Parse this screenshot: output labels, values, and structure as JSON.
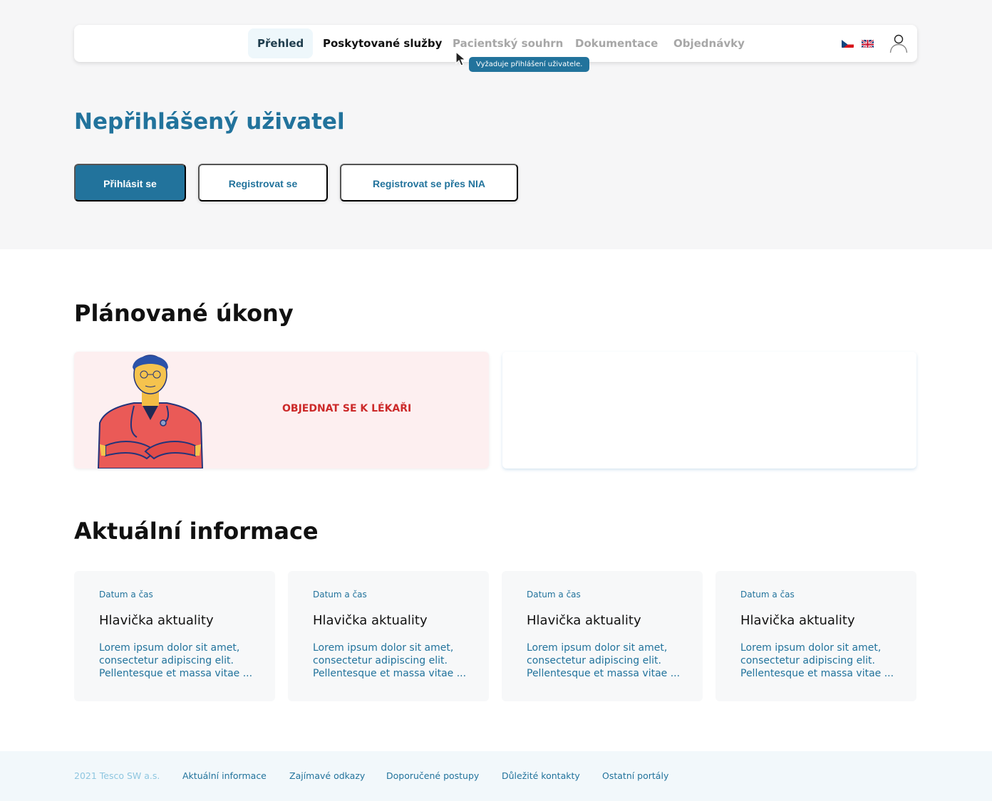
{
  "nav": {
    "items": [
      {
        "label": "Přehled",
        "state": "active"
      },
      {
        "label": "Poskytované služby",
        "state": "normal"
      },
      {
        "label": "Pacientský souhrn",
        "state": "disabled"
      },
      {
        "label": "Dokumentace",
        "state": "disabled"
      },
      {
        "label": "Objednávky",
        "state": "disabled"
      }
    ],
    "languages": [
      "cs",
      "en"
    ]
  },
  "tooltip": {
    "text": "Vyžaduje přihlášení uživatele."
  },
  "user": {
    "title": "Nepřihlášený uživatel"
  },
  "auth": {
    "login_label": "Přihlásit se",
    "register_label": "Registrovat se",
    "register_nia_label": "Registrovat se přes NIA"
  },
  "planned": {
    "title": "Plánované úkony",
    "order_label": "OBJEDNAT SE K LÉKAŘI"
  },
  "news": {
    "title": "Aktuální informace",
    "items": [
      {
        "date": "Datum a čas",
        "title": "Hlavička aktuality",
        "text": "Lorem ipsum dolor sit amet, consectetur adipiscing elit. Pellentesque et massa vitae ..."
      },
      {
        "date": "Datum a čas",
        "title": "Hlavička aktuality",
        "text": "Lorem ipsum dolor sit amet, consectetur adipiscing elit. Pellentesque et massa vitae ..."
      },
      {
        "date": "Datum a čas",
        "title": "Hlavička aktuality",
        "text": "Lorem ipsum dolor sit amet, consectetur adipiscing elit. Pellentesque et massa vitae ..."
      },
      {
        "date": "Datum a čas",
        "title": "Hlavička aktuality",
        "text": "Lorem ipsum dolor sit amet, consectetur adipiscing elit. Pellentesque et massa vitae ..."
      }
    ]
  },
  "footer": {
    "copyright": "2021 Tesco SW a.s.",
    "links": [
      "Aktuální informace",
      "Zajímavé odkazy",
      "Doporučené postupy",
      "Důležité kontakty",
      "Ostatní portály"
    ]
  },
  "colors": {
    "primary": "#22739c",
    "accent_red": "#cc2a2a",
    "card_pink": "#fdeff0"
  }
}
